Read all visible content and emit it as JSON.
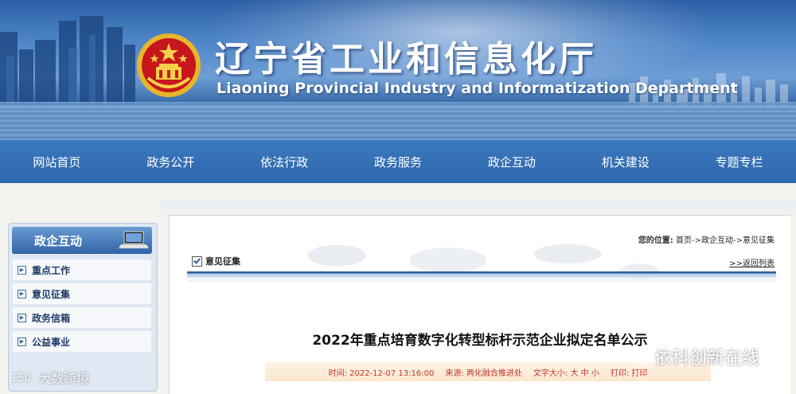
{
  "banner": {
    "title_cn": "辽宁省工业和信息化厅",
    "title_en": "Liaoning Provincial Industry and Informatization Department",
    "emblem_icon": "national-emblem-icon"
  },
  "nav": {
    "items": [
      {
        "label": "网站首页"
      },
      {
        "label": "政务公开"
      },
      {
        "label": "依法行政"
      },
      {
        "label": "政务服务"
      },
      {
        "label": "政企互动"
      },
      {
        "label": "机关建设"
      },
      {
        "label": "专题专栏"
      }
    ]
  },
  "sidebar": {
    "title": "政企互动",
    "icon": "laptop-icon",
    "items": [
      {
        "label": "重点工作"
      },
      {
        "label": "意见征集"
      },
      {
        "label": "政务信箱"
      },
      {
        "label": "公益事业"
      }
    ]
  },
  "breadcrumb": {
    "prefix": "您的位置:",
    "home": "首页",
    "sep1": "->",
    "section": "政企互动",
    "sep2": "->",
    "current": "意见征集"
  },
  "content": {
    "section_title": "意见征集",
    "back_link": ">>返回列表",
    "article_title": "2022年重点培育数字化转型标杆示范企业拟定名单公示",
    "meta": {
      "time": "时间: 2022-12-07 13:16:00",
      "source": "来源: 两化融合推进处",
      "font_size_label": "文字大小:",
      "size_large": "大",
      "size_medium": "中",
      "size_small": "小",
      "print": "打印: 打印"
    }
  },
  "watermarks": {
    "wechat_text": "依科创新在线",
    "left_text": "大数跨境",
    "left_logo_text": "150"
  },
  "colors": {
    "nav_bg": "#2d67ac",
    "accent_blue": "#2d5fa0",
    "meta_red": "#c0392b"
  }
}
